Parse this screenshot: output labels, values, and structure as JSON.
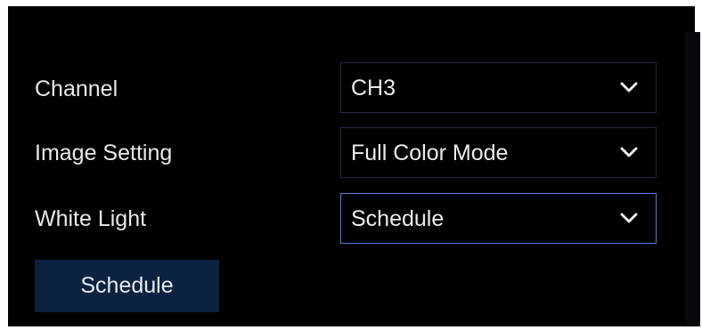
{
  "form": {
    "channel": {
      "label": "Channel",
      "value": "CH3"
    },
    "image_setting": {
      "label": "Image Setting",
      "value": "Full Color Mode"
    },
    "white_light": {
      "label": "White Light",
      "value": "Schedule"
    }
  },
  "buttons": {
    "schedule_label": "Schedule"
  },
  "colors": {
    "panel_bg": "#000000",
    "button_bg": "#0b2240",
    "focus_border": "#4e7fd0",
    "text": "#e8e8e8"
  },
  "icons": {
    "dropdown": "chevron-down-icon"
  }
}
